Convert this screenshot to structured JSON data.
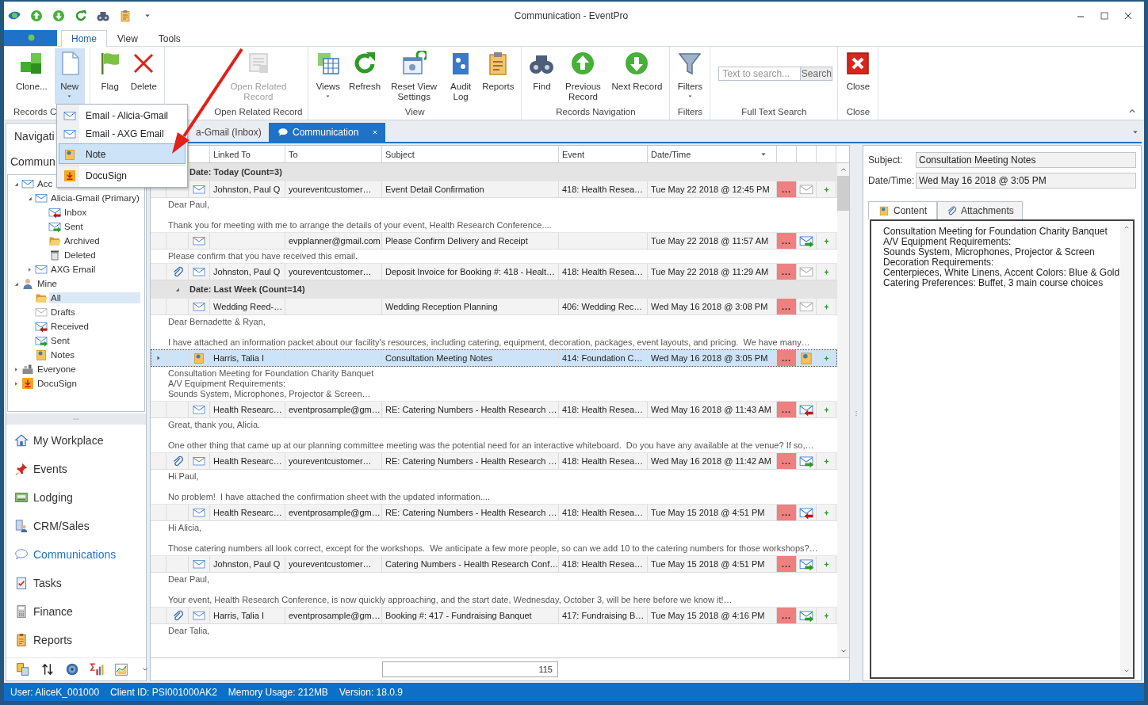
{
  "window": {
    "title": "Communication - EventPro"
  },
  "ribbon_tabs": [
    {
      "label": "Home",
      "selected": true
    },
    {
      "label": "View",
      "selected": false
    },
    {
      "label": "Tools",
      "selected": false
    }
  ],
  "ribbon_groups": [
    {
      "label": "Records C",
      "buttons": [
        {
          "label": "Clone...",
          "pressed": false,
          "disabled": false
        },
        {
          "label": "New",
          "pressed": true,
          "disabled": false,
          "dropdown": true
        }
      ]
    },
    {
      "buttons": [
        {
          "label": "Flag",
          "pressed": false,
          "disabled": false
        },
        {
          "label": "Delete",
          "pressed": false,
          "disabled": false
        }
      ]
    },
    {
      "label": "Open Related Record",
      "buttons": [
        {
          "label": "Open Related Record",
          "pressed": false,
          "disabled": true
        }
      ]
    },
    {
      "label": "View",
      "buttons": [
        {
          "label": "Views",
          "pressed": false,
          "disabled": false,
          "dropdown": true
        },
        {
          "label": "Refresh",
          "pressed": false,
          "disabled": false
        },
        {
          "label": "Reset View Settings",
          "pressed": false,
          "disabled": false
        },
        {
          "label": "Audit Log",
          "pressed": false,
          "disabled": false
        },
        {
          "label": "Reports",
          "pressed": false,
          "disabled": false
        }
      ]
    },
    {
      "label": "Records Navigation",
      "buttons": [
        {
          "label": "Find",
          "pressed": false,
          "disabled": false
        },
        {
          "label": "Previous Record",
          "pressed": false,
          "disabled": false
        },
        {
          "label": "Next Record",
          "pressed": false,
          "disabled": false
        }
      ]
    },
    {
      "label": "Filters",
      "buttons": [
        {
          "label": "Filters",
          "pressed": false,
          "disabled": false,
          "dropdown": true
        }
      ]
    },
    {
      "label": "Full Text Search",
      "search": {
        "placeholder": "Text to search...",
        "button": "Search"
      }
    },
    {
      "label": "Close",
      "buttons": [
        {
          "label": "Close",
          "pressed": false,
          "disabled": false
        }
      ]
    }
  ],
  "new_menu": [
    {
      "label": "Email - Alicia-Gmail",
      "selected": false
    },
    {
      "label": "Email - AXG Email",
      "selected": false
    },
    {
      "label": "Note",
      "selected": true
    },
    {
      "label": "DocuSign",
      "selected": false
    }
  ],
  "navigation": {
    "title": "Navigati",
    "section": "Commun",
    "tree": [
      {
        "label": "Acc",
        "kind": "account",
        "selected": false,
        "expanded": true,
        "children": [
          {
            "label": "Alicia-Gmail (Primary)",
            "kind": "account",
            "selected": false,
            "expanded": true,
            "children": [
              {
                "label": "Inbox",
                "kind": "inbox",
                "selected": false
              },
              {
                "label": "Sent",
                "kind": "sent",
                "selected": false
              },
              {
                "label": "Archived",
                "kind": "archived",
                "selected": false
              },
              {
                "label": "Deleted",
                "kind": "deleted",
                "selected": false
              }
            ]
          },
          {
            "label": "AXG Email",
            "kind": "account",
            "selected": false,
            "expanded": false
          }
        ]
      },
      {
        "label": "Mine",
        "kind": "person",
        "selected": false,
        "expanded": true,
        "children": [
          {
            "label": "All",
            "kind": "folder",
            "selected": true
          },
          {
            "label": "Drafts",
            "kind": "draft",
            "selected": false
          },
          {
            "label": "Received",
            "kind": "inbox",
            "selected": false
          },
          {
            "label": "Sent",
            "kind": "sent",
            "selected": false
          },
          {
            "label": "Notes",
            "kind": "note",
            "selected": false
          }
        ]
      },
      {
        "label": "Everyone",
        "kind": "group",
        "selected": false,
        "expanded": false
      },
      {
        "label": "DocuSign",
        "kind": "docusign",
        "selected": false,
        "expanded": false
      }
    ],
    "items": [
      {
        "label": "My Workplace",
        "selected": false
      },
      {
        "label": "Events",
        "selected": false
      },
      {
        "label": "Lodging",
        "selected": false
      },
      {
        "label": "CRM/Sales",
        "selected": false
      },
      {
        "label": "Communications",
        "selected": true
      },
      {
        "label": "Tasks",
        "selected": false
      },
      {
        "label": "Finance",
        "selected": false
      },
      {
        "label": "Reports",
        "selected": false
      }
    ]
  },
  "document_tabs": [
    {
      "label": "a-Gmail (Inbox)",
      "selected": false
    },
    {
      "label": "Communication",
      "selected": true
    }
  ],
  "grid": {
    "columns": [
      "Linked To",
      "To",
      "Subject",
      "Event",
      "Date/Time"
    ],
    "groups": [
      {
        "label": "Date: Today (Count=3)",
        "expanded": true,
        "rows": [
          {
            "selected": false,
            "attachment": false,
            "kind": "email",
            "linked_to": "Johnston, Paul Q",
            "to": "youreventcustomer…",
            "subject": "Event Detail Confirmation",
            "event": "418: Health Resea…",
            "date_time": "Tue May 22 2018 @ 12:45 PM",
            "more": "...",
            "sent": false,
            "received": false,
            "preview": [
              [
                "Dear Paul,"
              ],
              [
                "Thank you for meeting with me to arrange the details of your event, Health Research Conference...."
              ]
            ]
          },
          {
            "selected": false,
            "attachment": false,
            "kind": "email",
            "to": "evpplanner@gmail.com",
            "subject": "Please Confirm Delivery and Receipt",
            "date_time": "Tue May 22 2018 @ 11:57 AM",
            "more": "...",
            "sent": true,
            "received": false,
            "preview": [
              [
                "Please confirm that you have received this email."
              ]
            ]
          },
          {
            "selected": false,
            "attachment": true,
            "kind": "email",
            "linked_to": "Johnston, Paul Q",
            "to": "youreventcustomer…",
            "subject": "Deposit Invoice for Booking #: 418 - Healt…",
            "event": "418: Health Resea…",
            "date_time": "Tue May 22 2018 @ 11:29 AM",
            "more": "...",
            "sent": false,
            "received": false
          }
        ]
      },
      {
        "label": "Date: Last Week (Count=14)",
        "expanded": true,
        "rows": [
          {
            "selected": false,
            "attachment": false,
            "kind": "email",
            "linked_to": "Wedding Reed-…",
            "subject": "Wedding Reception Planning",
            "event": "406: Wedding Rec…",
            "date_time": "Wed May 16 2018 @ 3:08 PM",
            "more": "...",
            "sent": false,
            "received": false,
            "preview": [
              [
                "Dear Bernadette & Ryan,"
              ],
              [
                "I have attached an information packet about our facility's resources, including catering, equipment, decoration, packages, event layouts, and pricing.  We have many…"
              ]
            ]
          },
          {
            "selected": true,
            "attachment": false,
            "kind": "note",
            "linked_to": "Harris, Talia I",
            "subject": "Consultation Meeting Notes",
            "event": "414: Foundation C…",
            "date_time": "Wed May 16 2018 @ 3:05 PM",
            "more": "...",
            "preview": [
              [
                "Consultation Meeting for Foundation Charity Banquet",
                "A/V Equipment Requirements:",
                "Sounds System, Microphones, Projector & Screen…"
              ]
            ]
          },
          {
            "selected": false,
            "attachment": false,
            "kind": "email",
            "linked_to": "Health Researc…",
            "to": "eventprosample@gm…",
            "subject": "RE: Catering Numbers - Health Research …",
            "event": "418: Health Resea…",
            "date_time": "Wed May 16 2018 @ 11:43 AM",
            "more": "...",
            "sent": false,
            "received": true,
            "preview": [
              [
                "Great, thank you, Alicia."
              ],
              [
                "One other thing that came up at our planning committee meeting was the potential need for an interactive whiteboard.  Do you have any available at the venue? If so,…"
              ]
            ]
          },
          {
            "selected": false,
            "attachment": true,
            "kind": "email",
            "linked_to": "Health Researc…",
            "to": "youreventcustomer…",
            "subject": "RE: Catering Numbers - Health Research …",
            "event": "418: Health Resea…",
            "date_time": "Wed May 16 2018 @ 11:42 AM",
            "more": "...",
            "sent": true,
            "received": false,
            "preview": [
              [
                "Hi Paul,"
              ],
              [
                "No problem!  I have attached the confirmation sheet with the updated information...."
              ]
            ]
          },
          {
            "selected": false,
            "attachment": false,
            "kind": "email",
            "linked_to": "Health Researc…",
            "to": "eventprosample@gm…",
            "subject": "RE: Catering Numbers - Health Research …",
            "event": "418: Health Resea…",
            "date_time": "Tue May 15 2018 @ 4:51 PM",
            "more": "...",
            "sent": false,
            "received": true,
            "preview": [
              [
                "Hi Alicia,"
              ],
              [
                "Those catering numbers all look correct, except for the workshops.  We anticipate a few more people, so can we add 10 to the catering numbers for those workshops?…"
              ]
            ]
          },
          {
            "selected": false,
            "attachment": false,
            "kind": "email",
            "linked_to": "Johnston, Paul Q",
            "to": "youreventcustomer…",
            "subject": "Catering Numbers - Health Research Conf…",
            "event": "418: Health Resea…",
            "date_time": "Tue May 15 2018 @ 4:51 PM",
            "more": "...",
            "sent": true,
            "received": false,
            "preview": [
              [
                "Dear Paul,"
              ],
              [
                "Your event, Health Research Conference, is now quickly approaching, and the start date, Wednesday, October 3, will be here before we know it!…"
              ]
            ]
          },
          {
            "selected": false,
            "attachment": true,
            "kind": "email",
            "linked_to": "Harris, Talia I",
            "to": "eventprosample@gm…",
            "subject": "Booking #: 417 - Fundraising Banquet",
            "event": "417: Fundraising B…",
            "date_time": "Tue May 15 2018 @ 4:16 PM",
            "more": "...",
            "sent": true,
            "received": false,
            "preview": [
              [
                "Dear Talia,"
              ]
            ]
          }
        ]
      }
    ],
    "footer_count": "115"
  },
  "details": {
    "subject_label": "Subject:",
    "subject": "Consultation Meeting Notes",
    "date_label": "Date/Time:",
    "date_time": "Wed May 16 2018 @ 3:05 PM",
    "tabs": [
      {
        "label": "Content",
        "selected": true
      },
      {
        "label": "Attachments",
        "selected": false
      }
    ],
    "content": [
      "Consultation Meeting for Foundation Charity Banquet",
      "A/V Equipment Requirements:",
      "Sounds System, Microphones, Projector & Screen",
      "Decoration Requirements:",
      "Centerpieces, White Linens, Accent Colors: Blue & Gold",
      "Catering Preferences: Buffet, 3 main course choices"
    ]
  },
  "status_bar": [
    "User: AliceK_001000",
    "Client ID: PSI001000AK2",
    "Memory Usage: 212MB",
    "Version: 18.0.9"
  ]
}
